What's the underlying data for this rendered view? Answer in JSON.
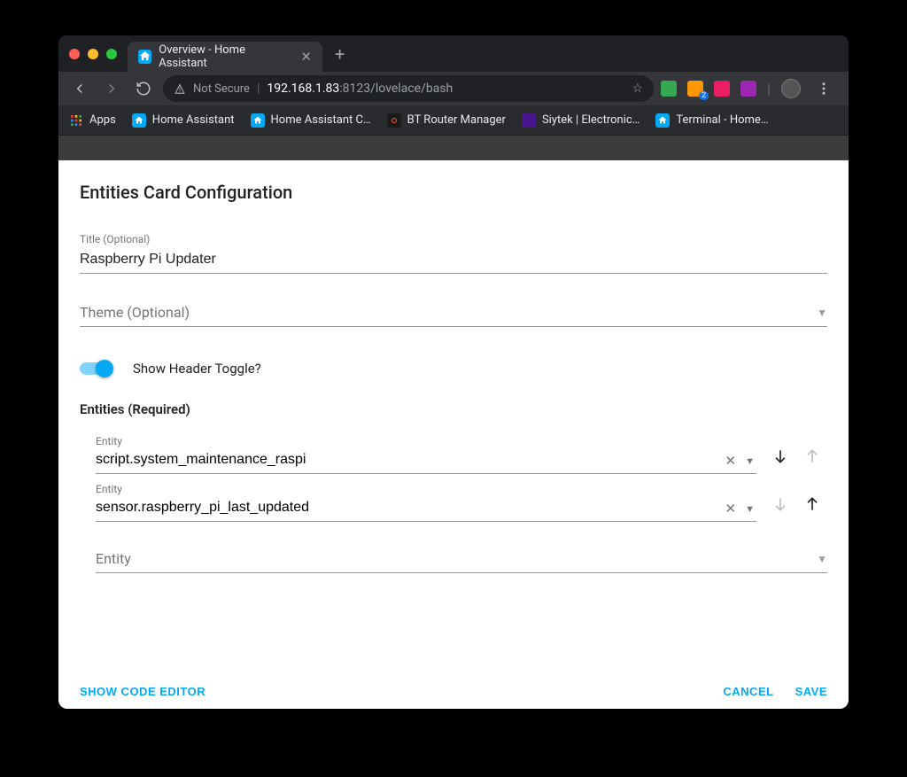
{
  "browser": {
    "tab_title": "Overview - Home Assistant",
    "not_secure_label": "Not Secure",
    "url_host": "192.168.1.83",
    "url_port": ":8123",
    "url_path": "/lovelace/bash",
    "bookmarks": {
      "apps": "Apps",
      "items": [
        {
          "label": "Home Assistant"
        },
        {
          "label": "Home Assistant C…"
        },
        {
          "label": "BT Router Manager"
        },
        {
          "label": "Siytek | Electronic…"
        },
        {
          "label": "Terminal - Home…"
        }
      ]
    }
  },
  "dialog": {
    "heading": "Entities Card Configuration",
    "title_field_label": "Title (Optional)",
    "title_value": "Raspberry Pi Updater",
    "theme_label": "Theme (Optional)",
    "toggle_label": "Show Header Toggle?",
    "toggle_on": true,
    "entities_heading": "Entities (Required)",
    "entity_label": "Entity",
    "entities": [
      {
        "value": "script.system_maintenance_raspi",
        "down_enabled": true,
        "up_enabled": false
      },
      {
        "value": "sensor.raspberry_pi_last_updated",
        "down_enabled": false,
        "up_enabled": true
      }
    ],
    "new_entity_placeholder": "Entity",
    "footer": {
      "show_code": "Show Code Editor",
      "cancel": "Cancel",
      "save": "Save"
    }
  }
}
